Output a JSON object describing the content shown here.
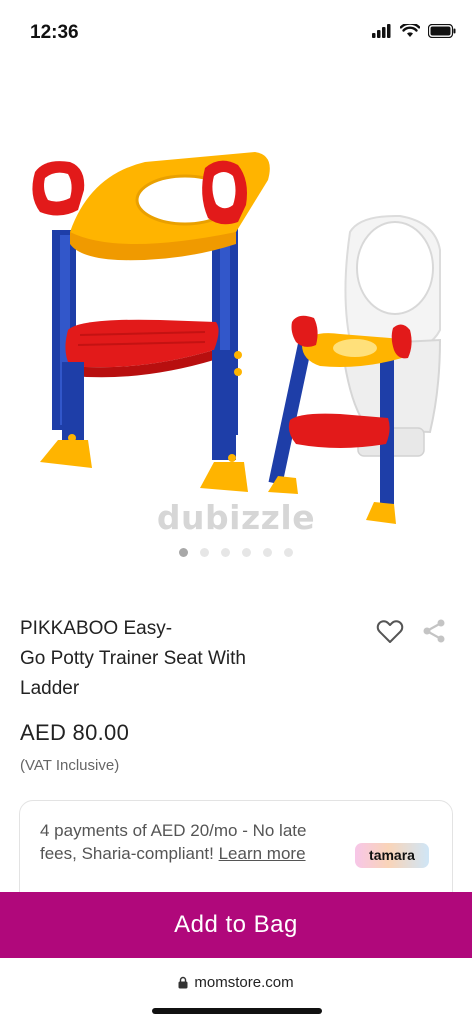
{
  "status_bar": {
    "time": "12:36",
    "icons": [
      "signal-icon",
      "wifi-icon",
      "battery-icon"
    ]
  },
  "gallery": {
    "watermark": "dubizzle",
    "dot_count": 6,
    "active_index": 0
  },
  "product": {
    "title_line1": "PIKKABOO Easy-",
    "title_line2": "Go Potty Trainer Seat With",
    "title_line3": "Ladder",
    "price": "AED 80.00",
    "vat": "(VAT Inclusive)"
  },
  "installment": {
    "text": "4 payments of AED 20/mo - No late fees, Sharia-compliant! ",
    "learn_more": "Learn more",
    "provider": "tamara"
  },
  "cta": {
    "add_to_bag": "Add to Bag"
  },
  "browser": {
    "url": "momstore.com"
  },
  "colors": {
    "accent": "#b0087b",
    "seat_yellow": "#ffb800",
    "frame_blue": "#2348b8",
    "step_red": "#e02020"
  }
}
